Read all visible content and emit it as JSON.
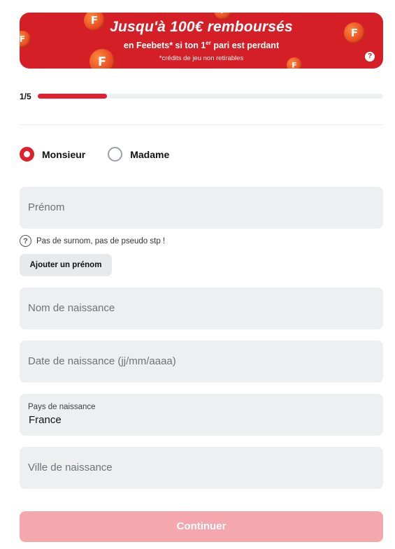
{
  "banner": {
    "title": "Jusqu'à 100€ remboursés",
    "subtitle_pre": "en Feebets* si ton 1",
    "subtitle_sup": "er",
    "subtitle_post": " pari est perdant",
    "note": "*crédits de jeu non retirables",
    "help": "?",
    "coin_letter": "F",
    "color": "#d41f26"
  },
  "progress": {
    "label": "1/5",
    "fraction": 0.2,
    "color": "#e0202d"
  },
  "civility": {
    "options": [
      {
        "label": "Monsieur",
        "checked": true
      },
      {
        "label": "Madame",
        "checked": false
      }
    ]
  },
  "fields": {
    "prenom_placeholder": "Prénom",
    "hint_icon": "?",
    "hint_text": "Pas de surnom, pas de pseudo stp !",
    "add_prenom_label": "Ajouter un prénom",
    "nom_placeholder": "Nom de naissance",
    "date_placeholder": "Date de naissance (jj/mm/aaaa)",
    "pays_label": "Pays de naissance",
    "pays_value": "France",
    "ville_placeholder": "Ville de naissance"
  },
  "continue_label": "Continuer",
  "icons": {
    "help": "question-circle-icon",
    "coin": "coin-icon"
  }
}
